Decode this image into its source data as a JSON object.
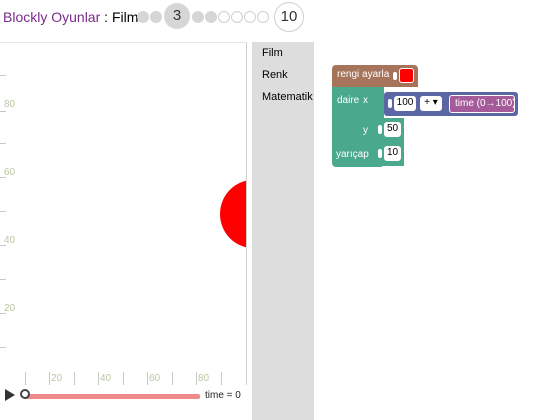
{
  "header": {
    "app_title": "Blockly Oyunlar",
    "separator": " : ",
    "page_title": "Film",
    "current_level": "3",
    "last_level": "10"
  },
  "visualization": {
    "y_labels": [
      "80",
      "60",
      "40",
      "20"
    ],
    "x_labels": [
      "20",
      "40",
      "60",
      "80"
    ],
    "circle_color": "#ff0000",
    "time_label": "time = 0"
  },
  "toolbox": {
    "items": [
      "Film",
      "Renk",
      "Matematik"
    ]
  },
  "blocks": {
    "set_color_label": "rengi ayarla",
    "set_color_value": "#ff0000",
    "circle_label": "daire",
    "x_label": "x",
    "y_label": "y",
    "radius_label": "yarıçap",
    "x_value": "100",
    "operator": "+ ▾",
    "time_label": "time (0→100)",
    "y_value": "50",
    "radius_value": "10"
  },
  "colors": {
    "title_purple": "#7a2c8c",
    "color_block": "#a5745b",
    "drawing_block": "#4aa88d",
    "math_block": "#5b67a5",
    "time_block": "#a55b99",
    "slider_track": "#f08a8a"
  }
}
